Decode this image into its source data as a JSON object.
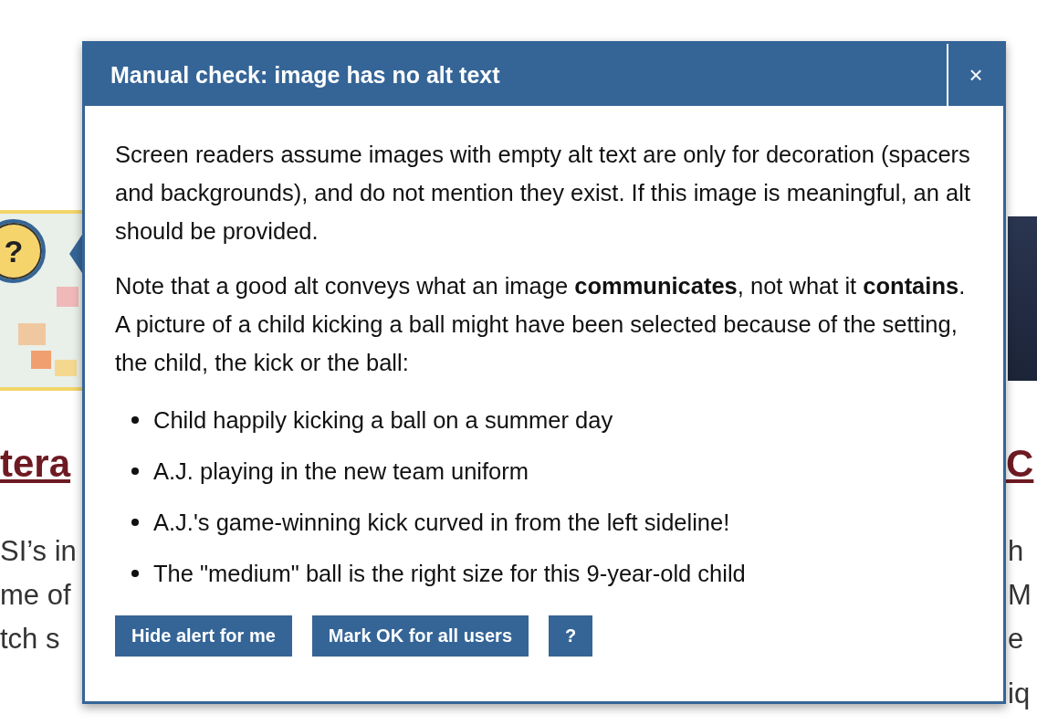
{
  "background": {
    "left_heading": "tera",
    "left_lines": [
      "SI’s in",
      "me of",
      "tch s"
    ],
    "right_heading": "C",
    "right_lines": [
      "h",
      "M",
      "e",
      "iq"
    ],
    "badge": "?"
  },
  "dialog": {
    "title": "Manual check: image has no alt text",
    "close": "×",
    "paragraphs": [
      "Screen readers assume images with empty alt text are only for decoration (spacers and backgrounds), and do not mention they exist. If this image is meaningful, an alt should be provided.",
      "Note that a good alt conveys what an image **communicates**, not what it **contains**. A picture of a child kicking a ball might have been selected because of the setting, the child, the kick or the ball:"
    ],
    "examples": [
      "Child happily kicking a ball on a summer day",
      "A.J. playing in the new team uniform",
      "A.J.'s game-winning kick curved in from the left sideline!",
      "The \"medium\" ball is the right size for this 9-year-old child"
    ],
    "buttons": [
      "Hide alert for me",
      "Mark OK for all users",
      "?"
    ]
  }
}
